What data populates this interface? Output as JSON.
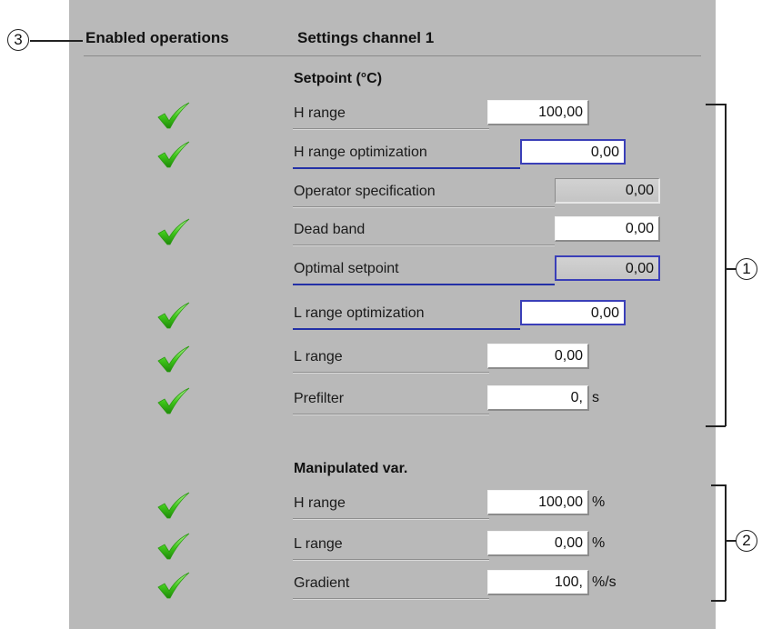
{
  "header": {
    "enabled_operations": "Enabled operations",
    "settings_title": "Settings channel 1"
  },
  "setpoint": {
    "title": "Setpoint (°C)",
    "rows": [
      {
        "label": "H range",
        "value": "100,00",
        "unit": "",
        "enabled": true
      },
      {
        "label": "H range optimization",
        "value": "0,00",
        "unit": "",
        "enabled": true
      },
      {
        "label": "Operator specification",
        "value": "0,00",
        "unit": "",
        "enabled": false
      },
      {
        "label": "Dead band",
        "value": "0,00",
        "unit": "",
        "enabled": true
      },
      {
        "label": "Optimal setpoint",
        "value": "0,00",
        "unit": "",
        "enabled": false
      },
      {
        "label": "L range optimization",
        "value": "0,00",
        "unit": "",
        "enabled": true
      },
      {
        "label": "L range",
        "value": "0,00",
        "unit": "",
        "enabled": true
      },
      {
        "label": "Prefilter",
        "value": "0,",
        "unit": "s",
        "enabled": true
      }
    ]
  },
  "manipulated": {
    "title": "Manipulated var.",
    "rows": [
      {
        "label": "H range",
        "value": "100,00",
        "unit": "%",
        "enabled": true
      },
      {
        "label": "L range",
        "value": "0,00",
        "unit": "%",
        "enabled": true
      },
      {
        "label": "Gradient",
        "value": "100,",
        "unit": "%/s",
        "enabled": true
      }
    ]
  },
  "callouts": {
    "c1": "1",
    "c2": "2",
    "c3": "3"
  },
  "colors": {
    "panel_bg": "#b9b9b9",
    "focus_blue": "#3a3fb8",
    "check_green": "#3ec61a"
  },
  "icons": {
    "enabled": "check-icon"
  }
}
